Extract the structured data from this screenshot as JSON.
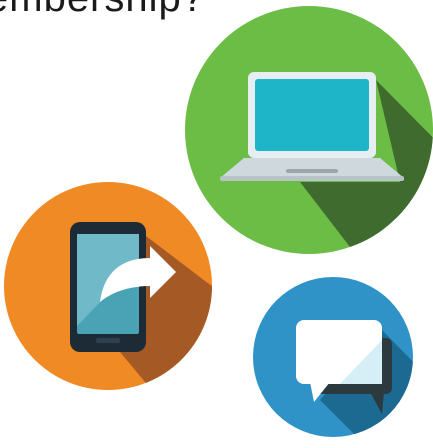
{
  "headline": {
    "text": "embership?"
  },
  "icons": [
    {
      "name": "laptop-icon",
      "circle_color": "#6bbd45",
      "shadow_color": "#3f6b2f",
      "screen_color": "#1fb5c9",
      "frame_color": "#e6eef2"
    },
    {
      "name": "smartphone-share-icon",
      "circle_color": "#f08a24",
      "shadow_color": "#a55a26",
      "screen_color": "#4aa3b5",
      "frame_color": "#1c2b35"
    },
    {
      "name": "chat-bubble-icon",
      "circle_color": "#2f93c8",
      "shadow_color": "#1c6a92",
      "bubble_color": "#ffffff",
      "back_bubble_color": "#2c3a3f"
    }
  ]
}
